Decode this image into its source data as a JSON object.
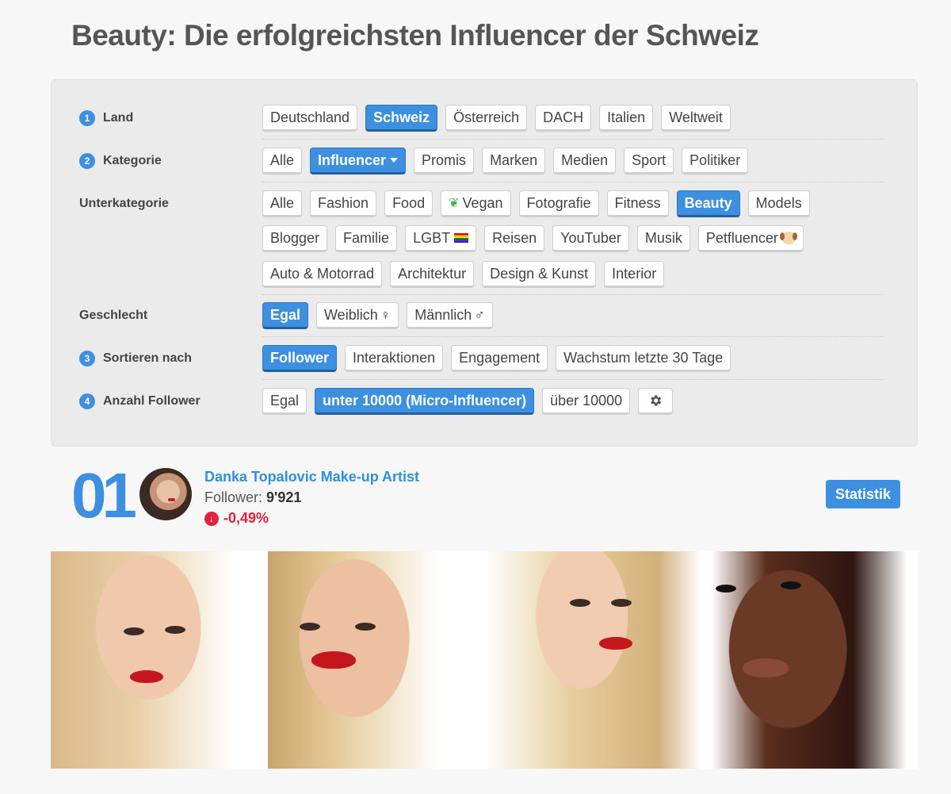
{
  "title": "Beauty: Die erfolgreichsten Influencer der Schweiz",
  "filters": {
    "land": {
      "step": "1",
      "label": "Land",
      "options": [
        "Deutschland",
        "Schweiz",
        "Österreich",
        "DACH",
        "Italien",
        "Weltweit"
      ],
      "selected": "Schweiz"
    },
    "kategorie": {
      "step": "2",
      "label": "Kategorie",
      "options": [
        "Alle",
        "Influencer",
        "Promis",
        "Marken",
        "Medien",
        "Sport",
        "Politiker"
      ],
      "selected": "Influencer"
    },
    "unterkategorie": {
      "label": "Unterkategorie",
      "row1": [
        "Alle",
        "Fashion",
        "Food",
        "Vegan",
        "Fotografie",
        "Fitness",
        "Beauty",
        "Models"
      ],
      "row2": [
        "Blogger",
        "Familie",
        "LGBT",
        "Reisen",
        "YouTuber",
        "Musik",
        "Petfluencer"
      ],
      "row3": [
        "Auto & Motorrad",
        "Architektur",
        "Design & Kunst",
        "Interior"
      ],
      "selected": "Beauty"
    },
    "geschlecht": {
      "label": "Geschlecht",
      "options": [
        "Egal",
        "Weiblich",
        "Männlich"
      ],
      "symbols": [
        "♀",
        "♂"
      ],
      "selected": "Egal"
    },
    "sortieren": {
      "step": "3",
      "label": "Sortieren nach",
      "options": [
        "Follower",
        "Interaktionen",
        "Engagement",
        "Wachstum letzte 30 Tage"
      ],
      "selected": "Follower"
    },
    "anzahl": {
      "step": "4",
      "label": "Anzahl Follower",
      "options": [
        "Egal",
        "unter 10000 (Micro-Influencer)",
        "über 10000"
      ],
      "selected": "unter 10000 (Micro-Influencer)",
      "settings_icon": "gear-icon"
    }
  },
  "result": {
    "rank": "01",
    "name": "Danka Topalovic Make-up Artist",
    "follower_label": "Follower:",
    "follower_count": "9'921",
    "change": "-0,49%",
    "change_direction": "down",
    "stat_button": "Statistik"
  },
  "colors": {
    "accent": "#3d8fe0",
    "negative": "#e0203e"
  }
}
